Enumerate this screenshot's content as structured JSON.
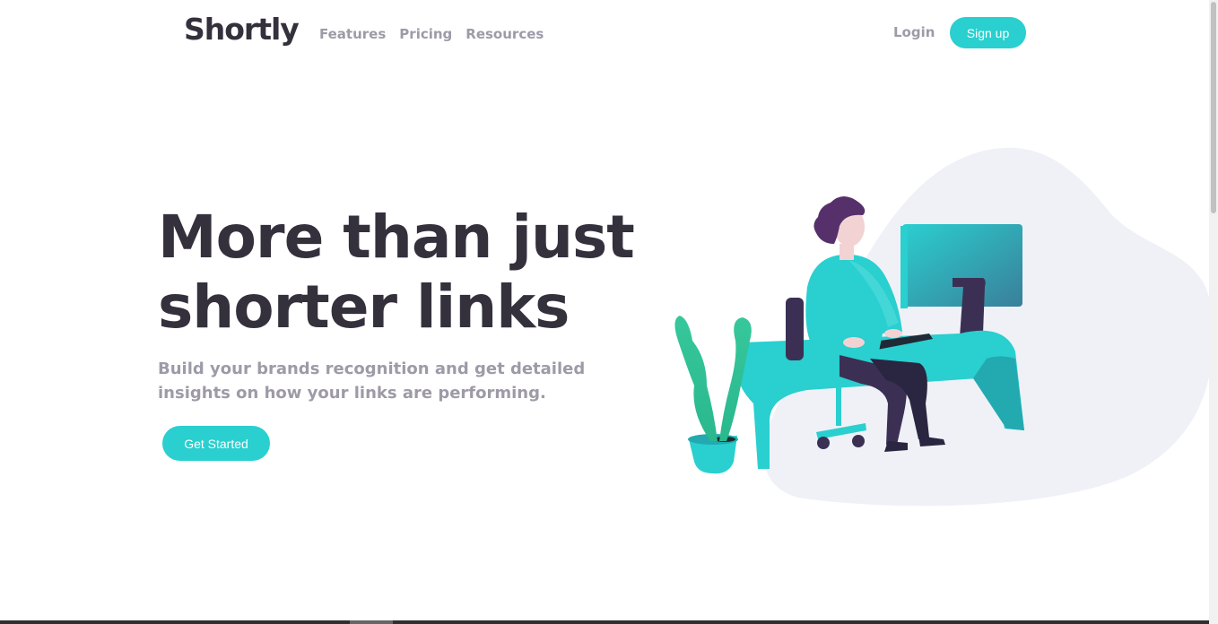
{
  "brand": {
    "name": "Shortly",
    "accent_color": "#2acfcf",
    "dark_color": "#34313d",
    "muted_color": "#9e9aa7"
  },
  "nav": {
    "links": [
      {
        "label": "Features"
      },
      {
        "label": "Pricing"
      },
      {
        "label": "Resources"
      }
    ],
    "login_label": "Login",
    "signup_label": "Sign up"
  },
  "hero": {
    "title_line1": "More than just",
    "title_line2": "shorter links",
    "subtitle": "Build your brands recognition and get detailed insights on how your links are performing.",
    "cta_label": "Get Started"
  },
  "illustration": {
    "icon": "person-working-at-desk-illustration"
  }
}
